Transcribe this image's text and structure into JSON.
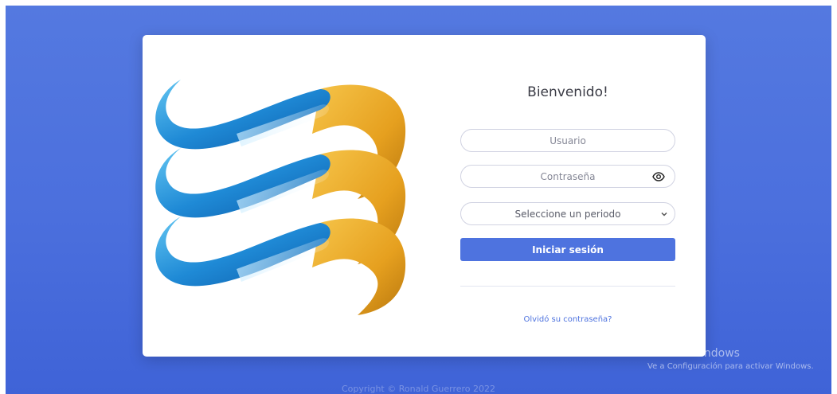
{
  "login": {
    "title": "Bienvenido!",
    "username_placeholder": "Usuario",
    "password_placeholder": "Contraseña",
    "period_select_value": "Seleccione un periodo",
    "submit_label": "Iniciar sesión",
    "forgot_link": "Olvidó su contraseña?"
  },
  "watermark": {
    "line1": "Activar Windows",
    "line2": "Ve a Configuración para activar Windows."
  },
  "footer": {
    "copyright": "Copyright © Ronald Guerrero 2022"
  },
  "icons": {
    "password_toggle": "eye-icon",
    "select_arrow": "chevron-down-icon"
  },
  "colors": {
    "background": "#4b6fdd",
    "primary": "#4e73df",
    "logo_blue": "#2a8ad6",
    "logo_gold": "#e8a92a"
  }
}
